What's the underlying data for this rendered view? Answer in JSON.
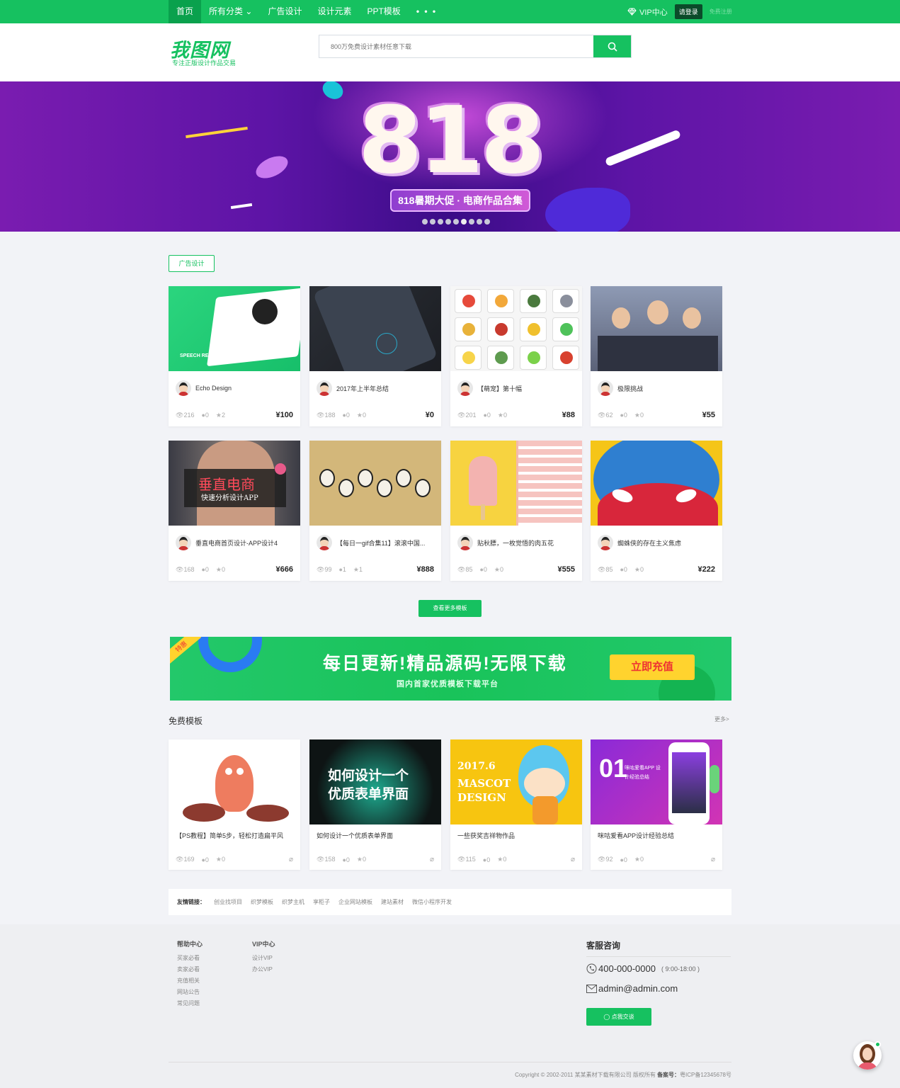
{
  "nav": {
    "items": [
      "首页",
      "所有分类",
      "广告设计",
      "设计元素",
      "PPT模板"
    ],
    "more": "• • •",
    "vip": "VIP中心",
    "login": "请登录",
    "register": "免费注册"
  },
  "header": {
    "logo": "我图网",
    "slogan": "专注正版设计作品交易",
    "search_placeholder": "800万免费设计素材任意下载"
  },
  "banner": {
    "big_text": "818",
    "tag": "818暑期大促 · 电商作品合集",
    "dots": 9,
    "active_dot": 5
  },
  "section": {
    "tag": "广告设计",
    "more_button": "查看更多模板"
  },
  "cards": [
    {
      "title": "Echo Design",
      "views": "216",
      "comments": "0",
      "stars": "2",
      "price": "¥100",
      "thumb_text": "SPEECH RECOGNITION"
    },
    {
      "title": "2017年上半年总结",
      "views": "188",
      "comments": "0",
      "stars": "0",
      "price": "¥0"
    },
    {
      "title": "【萌宠】第十幅",
      "views": "201",
      "comments": "0",
      "stars": "0",
      "price": "¥88"
    },
    {
      "title": "极限挑战",
      "views": "62",
      "comments": "0",
      "stars": "0",
      "price": "¥55"
    },
    {
      "title": "垂直电商首页设计-APP设计4",
      "views": "168",
      "comments": "0",
      "stars": "0",
      "price": "¥666",
      "thumb_text": "垂直电商",
      "thumb_sub": "快速分析设计APP"
    },
    {
      "title": "【每日一gif合集11】滚滚中国...",
      "views": "99",
      "comments": "1",
      "stars": "1",
      "price": "¥888"
    },
    {
      "title": "贴秋膘，一枚觉悟的肉五花",
      "views": "85",
      "comments": "0",
      "stars": "0",
      "price": "¥555"
    },
    {
      "title": "蜘蛛侠的存在主义焦虑",
      "views": "85",
      "comments": "0",
      "stars": "0",
      "price": "¥222"
    }
  ],
  "ad": {
    "badge": "特惠",
    "title": "每日更新!精品源码!无限下载",
    "subtitle": "国内首家优质模板下载平台",
    "button": "立即充值"
  },
  "free": {
    "title": "免费模板",
    "more": "更多>",
    "items": [
      {
        "title": "【PS教程】简单5步，轻松打造扁平风",
        "views": "169",
        "comments": "0",
        "stars": "0"
      },
      {
        "title": "如何设计一个优质表单界面",
        "views": "158",
        "comments": "0",
        "stars": "0",
        "thumb_text": "如何设计一个",
        "thumb_sub": "优质表单界面"
      },
      {
        "title": "一些获奖吉祥物作品",
        "views": "115",
        "comments": "0",
        "stars": "0",
        "thumb_text": "2017.6",
        "thumb_sub": "MASCOT DESIGN"
      },
      {
        "title": "咪咕爱看APP设计经验总结",
        "views": "92",
        "comments": "0",
        "stars": "0",
        "thumb_text": "01",
        "thumb_sub": "咪咕爱看APP 设计经验总结"
      }
    ]
  },
  "links": {
    "label": "友情链接：",
    "items": [
      "创业找项目",
      "织梦模板",
      "织梦主机",
      "享柜子",
      "企业网站模板",
      "建站素材",
      "微信小程序开发"
    ]
  },
  "footer": {
    "help": {
      "title": "帮助中心",
      "items": [
        "买家必看",
        "卖家必看",
        "充值相关",
        "网站公告",
        "常见问题"
      ]
    },
    "vip": {
      "title": "VIP中心",
      "items": [
        "设计VIP",
        "办公VIP"
      ]
    },
    "service_title": "客服咨询",
    "phone": "400-000-0000",
    "hours": "( 9:00-18:00 )",
    "email": "admin@admin.com",
    "qq_button": "点我交谈",
    "copyright": "Copyright © 2002-2011 某某素材下载有限公司 版权所有",
    "icp_label": "备案号：",
    "icp": "粤ICP备12345678号"
  },
  "colors": {
    "brand": "#16c160",
    "brand_dark": "#0aa14d",
    "banner": "#6a18b0",
    "button_yellow": "#ffd32e"
  }
}
